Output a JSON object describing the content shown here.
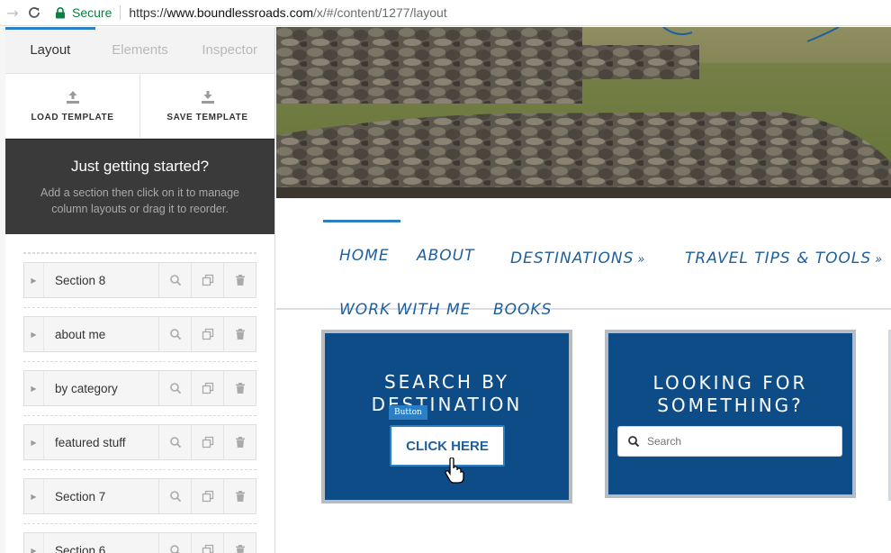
{
  "browser": {
    "secure_label": "Secure",
    "url_scheme": "https://",
    "url_host": "www.boundlessroads.com",
    "url_path": "/x/#/content/1277/layout"
  },
  "panel": {
    "tabs": [
      {
        "label": "Layout",
        "active": true
      },
      {
        "label": "Elements",
        "active": false
      },
      {
        "label": "Inspector",
        "active": false
      }
    ],
    "load_template": "LOAD TEMPLATE",
    "save_template": "SAVE TEMPLATE",
    "started_title": "Just getting started?",
    "started_text": "Add a section then click on it to manage column layouts or drag it to reorder.",
    "sections": [
      {
        "label": "Section 8"
      },
      {
        "label": "about me"
      },
      {
        "label": "by category"
      },
      {
        "label": "featured stuff"
      },
      {
        "label": "Section 7"
      },
      {
        "label": "Section 6"
      }
    ]
  },
  "site": {
    "nav": {
      "home": "HOME",
      "about": "ABOUT",
      "destinations": "DESTINATIONS",
      "travel_tips": "TRAVEL TIPS & TOOLS",
      "work_with_me": "WORK WITH ME",
      "books": "BOOKS"
    },
    "widget1": {
      "title_line1": "SEARCH BY",
      "title_line2": "DESTINATION",
      "tag": "Button",
      "button": "CLICK HERE"
    },
    "widget2": {
      "title_line1": "LOOKING FOR",
      "title_line2": "SOMETHING?",
      "search_placeholder": "Search"
    }
  },
  "colors": {
    "accent": "#2c7fc2",
    "brand_blue": "#0d4c87",
    "dark_panel": "#3a3a3a"
  }
}
